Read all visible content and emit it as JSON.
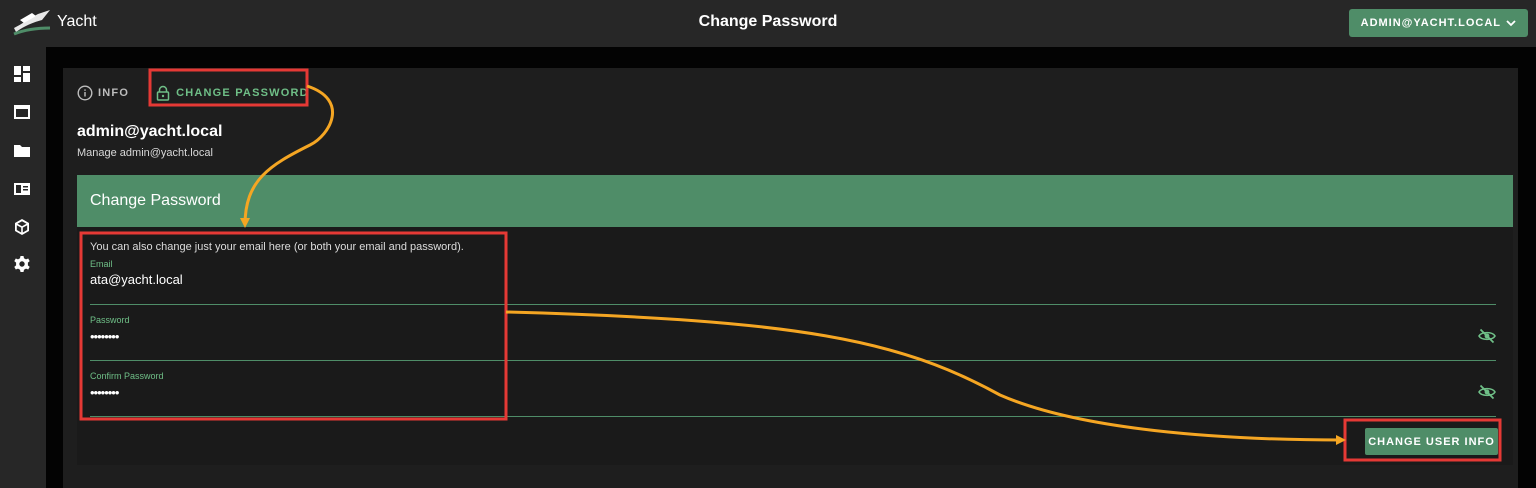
{
  "appbar": {
    "app_name": "Yacht",
    "page_title": "Change Password",
    "user_menu_label": "ADMIN@YACHT.LOCAL"
  },
  "sidebar": {
    "items": [
      {
        "icon": "dashboard-icon"
      },
      {
        "icon": "window-icon"
      },
      {
        "icon": "folder-icon"
      },
      {
        "icon": "template-icon"
      },
      {
        "icon": "box-icon"
      },
      {
        "icon": "gear-icon"
      }
    ]
  },
  "tabs": [
    {
      "label": "INFO",
      "icon": "info-icon"
    },
    {
      "label": "CHANGE PASSWORD",
      "icon": "lock-icon",
      "active": true
    }
  ],
  "account": {
    "email": "admin@yacht.local",
    "subtitle": "Manage admin@yacht.local"
  },
  "form": {
    "title": "Change Password",
    "hint": "You can also change just your email here (or both your email and password).",
    "email_label": "Email",
    "email_value": "ata@yacht.local",
    "password_label": "Password",
    "password_value": "••••••••",
    "confirm_label": "Confirm Password",
    "confirm_value": "••••••••",
    "submit_label": "CHANGE USER INFO"
  },
  "colors": {
    "accent": "#4f8d68",
    "accent_text": "#6fbf87",
    "annotation_box": "#e53935",
    "annotation_arrow": "#f5a623"
  }
}
